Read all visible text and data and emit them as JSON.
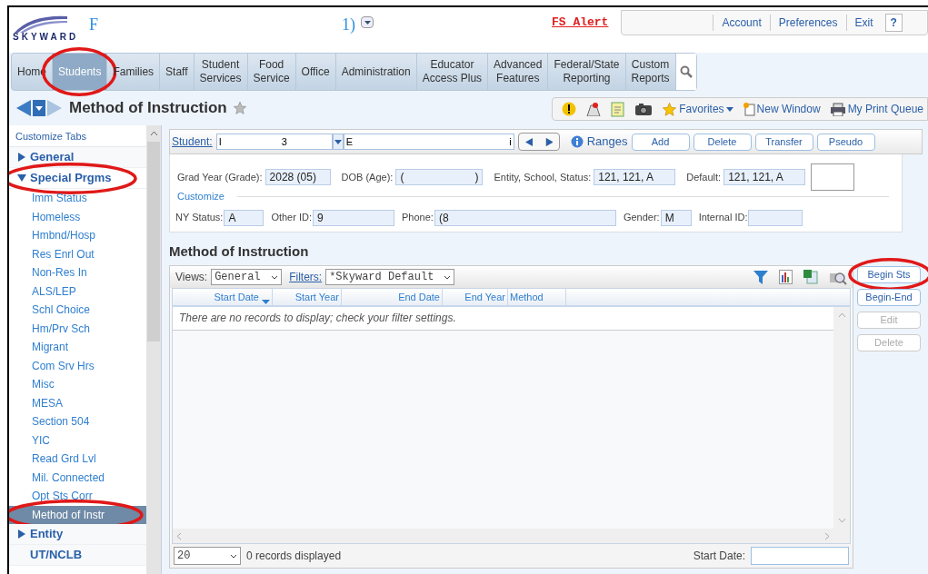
{
  "header": {
    "logo": "SKYWARD",
    "title_start": "F",
    "title_end": "1)",
    "alert": "FS Alert",
    "user_links": [
      "Account",
      "Preferences",
      "Exit"
    ],
    "help": "?"
  },
  "nav": [
    {
      "label": "Home",
      "selected": false,
      "circled": false
    },
    {
      "label": "Students",
      "selected": true,
      "circled": true
    },
    {
      "label": "Families",
      "selected": false,
      "circled": false
    },
    {
      "label": "Staff",
      "selected": false,
      "circled": false
    },
    {
      "label": "Student Services",
      "selected": false,
      "circled": false
    },
    {
      "label": "Food Service",
      "selected": false,
      "circled": false
    },
    {
      "label": "Office",
      "selected": false,
      "circled": false
    },
    {
      "label": "Administration",
      "selected": false,
      "circled": false
    },
    {
      "label": "Educator Access Plus",
      "selected": false,
      "circled": false
    },
    {
      "label": "Advanced Features",
      "selected": false,
      "circled": false
    },
    {
      "label": "Federal/State Reporting",
      "selected": false,
      "circled": false
    },
    {
      "label": "Custom Reports",
      "selected": false,
      "circled": false
    }
  ],
  "page_title": "Method of Instruction",
  "toolbar": {
    "favorites": "Favorites",
    "new_window": "New Window",
    "print_queue": "My Print Queue"
  },
  "sidebar": {
    "customize": "Customize Tabs",
    "items": [
      {
        "label": "General",
        "kind": "group",
        "expanded": false,
        "circled": false
      },
      {
        "label": "Special Prgms",
        "kind": "group",
        "expanded": true,
        "circled": true,
        "children": [
          {
            "label": "Imm Status",
            "selected": false,
            "circled": false
          },
          {
            "label": "Homeless",
            "selected": false,
            "circled": false
          },
          {
            "label": "Hmbnd/Hosp",
            "selected": false,
            "circled": false
          },
          {
            "label": "Res Enrl Out",
            "selected": false,
            "circled": false
          },
          {
            "label": "Non-Res In",
            "selected": false,
            "circled": false
          },
          {
            "label": "ALS/LEP",
            "selected": false,
            "circled": false
          },
          {
            "label": "Schl Choice",
            "selected": false,
            "circled": false
          },
          {
            "label": "Hm/Prv Sch",
            "selected": false,
            "circled": false
          },
          {
            "label": "Migrant",
            "selected": false,
            "circled": false
          },
          {
            "label": "Com Srv Hrs",
            "selected": false,
            "circled": false
          },
          {
            "label": "Misc",
            "selected": false,
            "circled": false
          },
          {
            "label": "MESA",
            "selected": false,
            "circled": false
          },
          {
            "label": "Section 504",
            "selected": false,
            "circled": false
          },
          {
            "label": "YIC",
            "selected": false,
            "circled": false
          },
          {
            "label": "Read Grd Lvl",
            "selected": false,
            "circled": false
          },
          {
            "label": "Mil. Connected",
            "selected": false,
            "circled": false
          },
          {
            "label": "Opt Sts Corr",
            "selected": false,
            "circled": false
          },
          {
            "label": "Method of Instr",
            "selected": true,
            "circled": true
          }
        ]
      },
      {
        "label": "Entity",
        "kind": "group",
        "expanded": false,
        "circled": false
      },
      {
        "label": "UT/NCLB",
        "kind": "link",
        "circled": false
      }
    ]
  },
  "student_bar": {
    "label": "Student:",
    "id_start": "I",
    "id_mid": "3",
    "name_start": "E",
    "name_end": "i",
    "ranges": "Ranges",
    "buttons": [
      "Add",
      "Delete",
      "Transfer",
      "Pseudo"
    ]
  },
  "info": {
    "row1": [
      {
        "label": "Grad Year (Grade):",
        "value": "2028 (05)"
      },
      {
        "label": "DOB (Age):",
        "value": "(",
        "value_end": ")"
      },
      {
        "label": "Entity, School, Status:",
        "value": "121, 121, A"
      },
      {
        "label": "Default:",
        "value": "121, 121, A"
      }
    ],
    "customize": "Customize",
    "row2": [
      {
        "label": "NY Status:",
        "value": "A"
      },
      {
        "label": "Other ID:",
        "value": "9"
      },
      {
        "label": "Phone:",
        "value": "(8"
      },
      {
        "label": "Gender:",
        "value": "M"
      },
      {
        "label": "Internal ID:"
      }
    ]
  },
  "section_title": "Method of Instruction",
  "grid": {
    "views_label": "Views:",
    "view": "General",
    "filters_label": "Filters:",
    "filter": "*Skyward Default",
    "columns": [
      {
        "label": "Start Date",
        "sorted": true
      },
      {
        "label": "Start Year",
        "sorted": false
      },
      {
        "label": "End Date",
        "sorted": false
      },
      {
        "label": "End Year",
        "sorted": false
      },
      {
        "label": "Method",
        "sorted": false
      }
    ],
    "empty": "There are no records to display; check your filter settings.",
    "page_size": "20",
    "count": "0 records displayed",
    "start_date_label": "Start Date:"
  },
  "side_buttons": [
    {
      "label": "Begin Sts",
      "disabled": false,
      "circled": true
    },
    {
      "label": "Begin-End",
      "disabled": false,
      "circled": false
    },
    {
      "label": "Edit",
      "disabled": true,
      "circled": false
    },
    {
      "label": "Delete",
      "disabled": true,
      "circled": false
    }
  ]
}
